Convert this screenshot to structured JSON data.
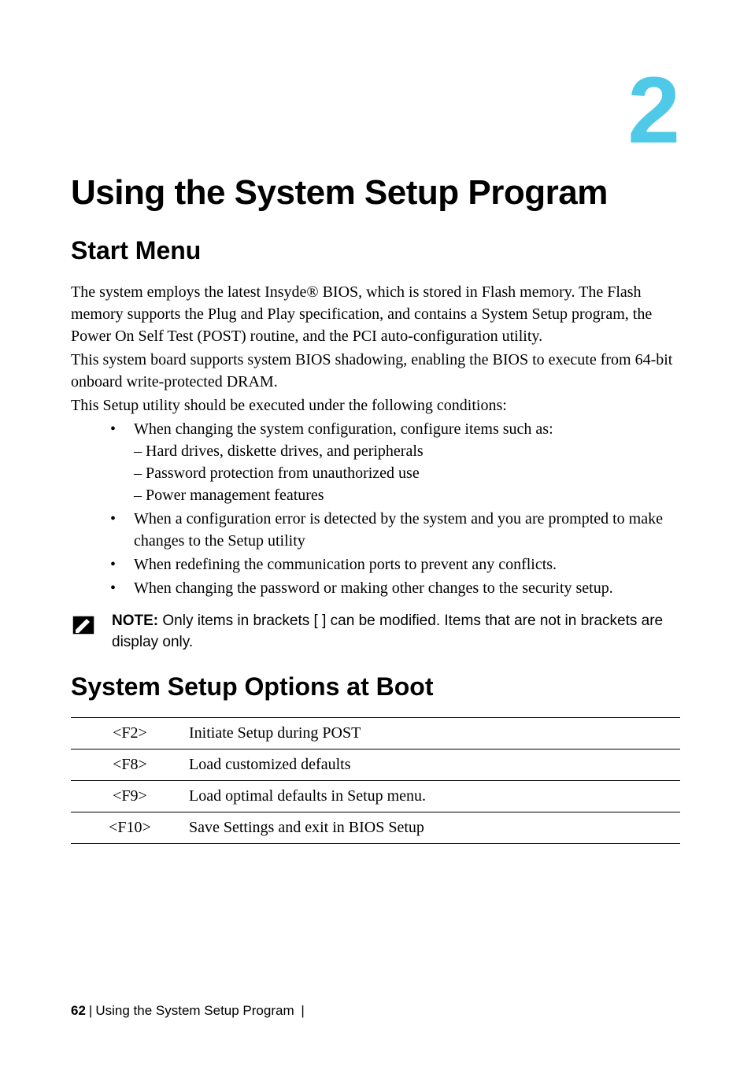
{
  "chapter": {
    "number": "2",
    "title": "Using the System Setup Program"
  },
  "section1": {
    "title": "Start Menu",
    "para1": "The system employs the latest Insyde® BIOS, which is stored in Flash memory. The Flash memory supports the Plug and Play specification, and contains a System Setup program, the Power On Self Test (POST) routine, and the PCI auto-configuration utility.",
    "para2": "This system board supports system BIOS shadowing, enabling the BIOS to execute from 64-bit onboard write-protected DRAM.",
    "para3": "This Setup utility should be executed under the following conditions:",
    "bullets": {
      "b1_main": "When changing the system configuration, configure items such as:",
      "b1_sub1": "– Hard drives, diskette drives, and peripherals",
      "b1_sub2": "– Password protection from unauthorized use",
      "b1_sub3": "– Power management features",
      "b2": "When a configuration error is detected by the system and you are prompted to make changes to the Setup utility",
      "b3": "When redefining the communication ports to prevent any conflicts.",
      "b4": "When changing the password or making other changes to the security setup."
    },
    "note": {
      "label": "NOTE:",
      "text": " Only items in brackets [ ] can be modified. Items that are not in brackets are display only."
    }
  },
  "section2": {
    "title": "System Setup Options at Boot",
    "rows": [
      {
        "key": "<F2>",
        "desc": "Initiate Setup during POST"
      },
      {
        "key": "<F8>",
        "desc": "Load customized defaults"
      },
      {
        "key": "<F9>",
        "desc": "Load optimal defaults in Setup menu."
      },
      {
        "key": "<F10>",
        "desc": "Save Settings and exit in BIOS Setup"
      }
    ]
  },
  "footer": {
    "page": "62",
    "title": "Using the System Setup Program"
  }
}
